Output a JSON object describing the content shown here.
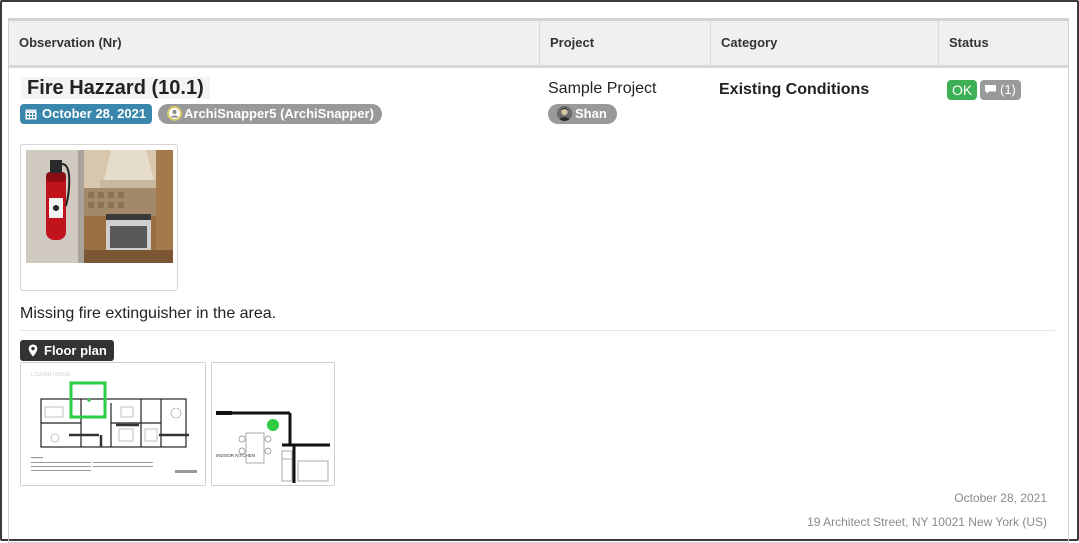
{
  "table": {
    "headers": [
      "Observation (Nr)",
      "Project",
      "Category",
      "Status"
    ]
  },
  "observation": {
    "title": "Fire Hazzard (10.1)",
    "date": "October 28, 2021",
    "author": "ArchiSnapper5 (ArchiSnapper)",
    "project": "Sample Project",
    "assignee": "Shan",
    "category": "Existing Conditions",
    "status": "OK",
    "comments": "(1)",
    "description": "Missing fire extinguisher in the area.",
    "floor_plan_label": "Floor plan",
    "floor_plan_text": {
      "plan_label": "LOUVER HOUSE",
      "detail_label": "INDOOR KITCHEN"
    },
    "footer_date": "October 28, 2021",
    "footer_address": "19 Architect Street, NY 10021 New York (US)"
  },
  "colors": {
    "date_badge": "#3a87ad",
    "ok_badge": "#3daf54",
    "gray_badge": "#999999",
    "marker_green": "#2ecc40"
  },
  "icons": {
    "date": "calendar-icon",
    "author": "user-icon",
    "comments": "comment-icon",
    "floor_plan": "map-pin-icon"
  }
}
